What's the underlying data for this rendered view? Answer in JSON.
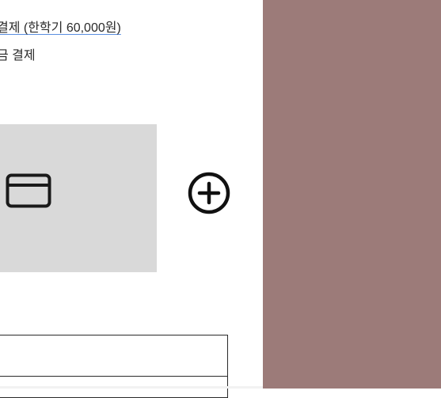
{
  "payment": {
    "link_text": "결제 (한학기 60,000원)",
    "subline_text": "금 결제"
  },
  "card_tile": {
    "icon": "credit-card-icon",
    "background": "#d9d9d9"
  },
  "add_button": {
    "icon": "plus-circle-icon"
  },
  "right_panel": {
    "background": "#9c7b79"
  }
}
